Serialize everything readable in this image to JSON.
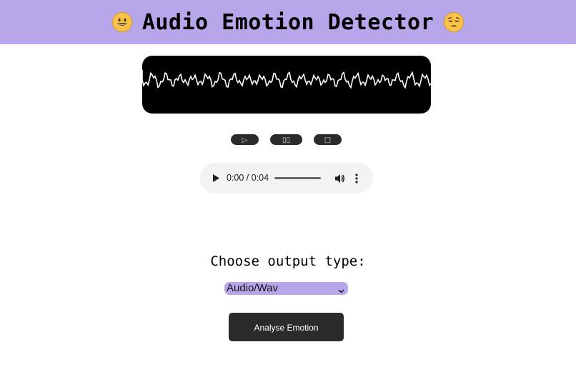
{
  "header": {
    "title": "Audio Emotion Detector",
    "left_emoji": "grinning-face-emoji",
    "right_emoji": "pensive-face-emoji",
    "background_color": "#b8a6ea"
  },
  "waveform": {
    "background_color": "#000000",
    "stroke_color": "#ffffff"
  },
  "controls": {
    "play_symbol": "▷",
    "pause_symbol": "▯▯",
    "stop_symbol": "□"
  },
  "audio_player": {
    "time_display": "0:00 / 0:04",
    "icons": [
      "play-icon",
      "volume-icon",
      "more-options-icon"
    ]
  },
  "output": {
    "label": "Choose output type:",
    "selected_option": "Audio/Wav",
    "select_color": "#b8a6ea"
  },
  "analyse_button": {
    "label": "Analyse Emotion"
  }
}
